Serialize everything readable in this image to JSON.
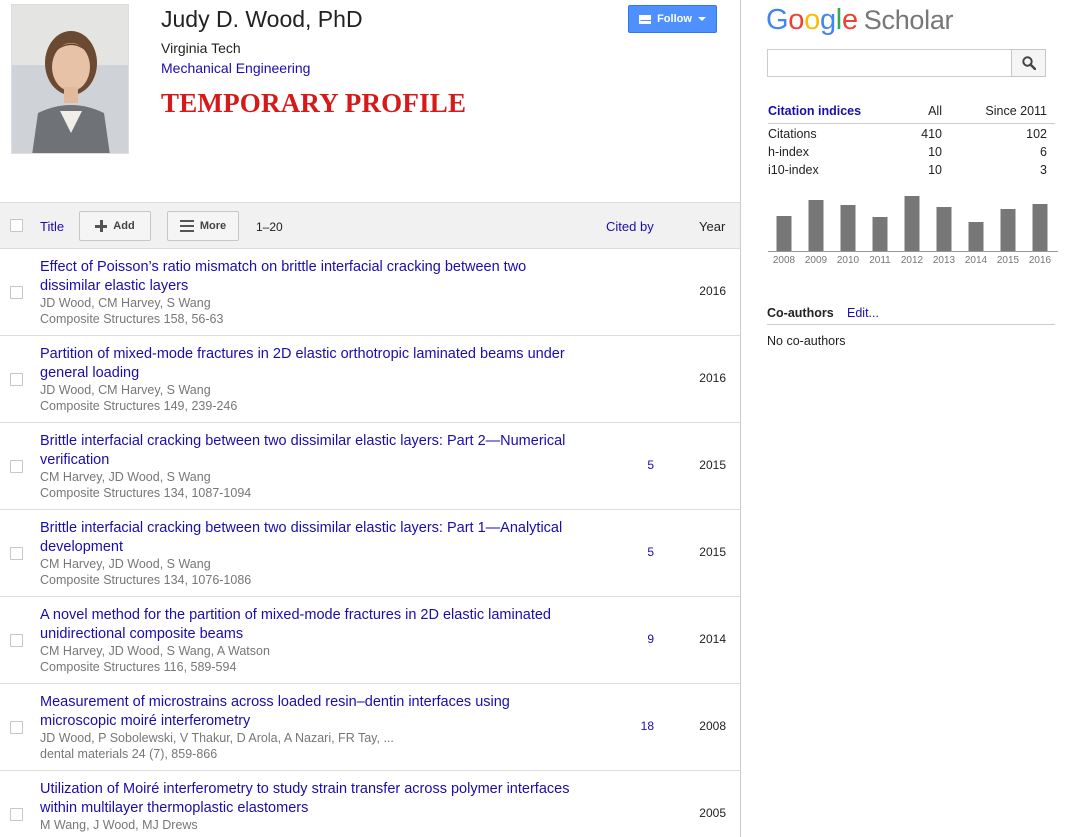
{
  "profile": {
    "name": "Judy D. Wood, PhD",
    "affiliation": "Virginia Tech",
    "department": "Mechanical Engineering",
    "banner": "TEMPORARY PROFILE",
    "follow_label": "Follow"
  },
  "toolbar": {
    "title_label": "Title",
    "add_label": "Add",
    "more_label": "More",
    "range": "1–20",
    "cited_by_label": "Cited by",
    "year_label": "Year"
  },
  "articles": [
    {
      "title": "Effect of Poisson’s ratio mismatch on brittle interfacial cracking between two dissimilar elastic layers",
      "authors": "JD Wood, CM Harvey, S Wang",
      "venue": "Composite Structures 158, 56-63",
      "cited": "",
      "year": "2016"
    },
    {
      "title": "Partition of mixed-mode fractures in 2D elastic orthotropic laminated beams under general loading",
      "authors": "JD Wood, CM Harvey, S Wang",
      "venue": "Composite Structures 149, 239-246",
      "cited": "",
      "year": "2016"
    },
    {
      "title": "Brittle interfacial cracking between two dissimilar elastic layers: Part 2—Numerical verification",
      "authors": "CM Harvey, JD Wood, S Wang",
      "venue": "Composite Structures 134, 1087-1094",
      "cited": "5",
      "year": "2015"
    },
    {
      "title": "Brittle interfacial cracking between two dissimilar elastic layers: Part 1—Analytical development",
      "authors": "CM Harvey, JD Wood, S Wang",
      "venue": "Composite Structures 134, 1076-1086",
      "cited": "5",
      "year": "2015"
    },
    {
      "title": "A novel method for the partition of mixed-mode fractures in 2D elastic laminated unidirectional composite beams",
      "authors": "CM Harvey, JD Wood, S Wang, A Watson",
      "venue": "Composite Structures 116, 589-594",
      "cited": "9",
      "year": "2014"
    },
    {
      "title": "Measurement of microstrains across loaded resin–dentin interfaces using microscopic moiré interferometry",
      "authors": "JD Wood, P Sobolewski, V Thakur, D Arola, A Nazari, FR Tay, ...",
      "venue": "dental materials 24 (7), 859-866",
      "cited": "18",
      "year": "2008"
    },
    {
      "title": "Utilization of Moiré interferometry to study strain transfer across polymer interfaces within multilayer thermoplastic elastomers",
      "authors": "M Wang, J Wood, MJ Drews",
      "venue": "",
      "cited": "",
      "year": "2005"
    }
  ],
  "sidebar": {
    "logo_google": "Google",
    "logo_scholar": "Scholar",
    "search_value": "",
    "citation_header": "Citation indices",
    "col_all": "All",
    "col_since": "Since 2011",
    "indices": [
      {
        "label": "Citations",
        "all": "410",
        "since": "102"
      },
      {
        "label": "h-index",
        "all": "10",
        "since": "6"
      },
      {
        "label": "i10-index",
        "all": "10",
        "since": "3"
      }
    ],
    "coauthors_header": "Co-authors",
    "coauthors_edit": "Edit...",
    "no_coauthors": "No co-authors"
  },
  "chart_data": {
    "type": "bar",
    "categories": [
      "2008",
      "2009",
      "2010",
      "2011",
      "2012",
      "2013",
      "2014",
      "2015",
      "2016"
    ],
    "values": [
      35,
      51,
      46,
      34,
      55,
      44,
      29,
      42,
      47
    ],
    "ylim": [
      0,
      60
    ],
    "bar_color": "#777777"
  },
  "colors": {
    "link": "#1a0dab",
    "follow_button": "#4d90fe",
    "banner_red": "#d61a1a"
  }
}
